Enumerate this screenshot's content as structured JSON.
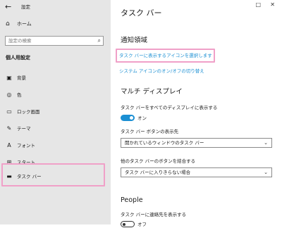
{
  "window": {
    "title": "設定",
    "controls": {
      "maximize": "□",
      "close": "✕"
    }
  },
  "sidebar": {
    "home_label": "ホーム",
    "search_placeholder": "設定の検索",
    "section_title": "個人用設定",
    "items": [
      {
        "label": "背景",
        "icon": "image-icon",
        "glyph": "▣"
      },
      {
        "label": "色",
        "icon": "palette-icon",
        "glyph": "◎"
      },
      {
        "label": "ロック画面",
        "icon": "lock-screen-icon",
        "glyph": "▭"
      },
      {
        "label": "テーマ",
        "icon": "theme-icon",
        "glyph": "✎"
      },
      {
        "label": "フォント",
        "icon": "font-icon",
        "glyph": "A"
      },
      {
        "label": "スタート",
        "icon": "start-icon",
        "glyph": "⊞"
      },
      {
        "label": "タスク バー",
        "icon": "taskbar-icon",
        "glyph": "▬",
        "selected": true
      }
    ]
  },
  "main": {
    "title": "タスク バー",
    "notification_area": {
      "heading": "通知領域",
      "link1": "タスク バーに表示するアイコンを選択します",
      "link2": "システム アイコンのオン/オフの切り替え"
    },
    "multi_display": {
      "heading": "マルチ ディスプレイ",
      "show_all_label": "タスク バーをすべてのディスプレイに表示する",
      "toggle_state": "オン",
      "buttons_show_on_label": "タスク バー ボタンの表示先",
      "buttons_show_on_value": "開かれているウィンドウのタスク バー",
      "combine_label": "他のタスク バーのボタンを結合する",
      "combine_value": "タスク バーに入りきらない場合"
    },
    "people": {
      "heading": "People",
      "show_contacts_label": "タスク バーに連絡先を表示する",
      "toggle_state": "オフ"
    }
  },
  "accent_colors": {
    "link": "#1b8fd3",
    "toggle_on": "#1b8fd3",
    "highlight": "#f0a0c8"
  }
}
